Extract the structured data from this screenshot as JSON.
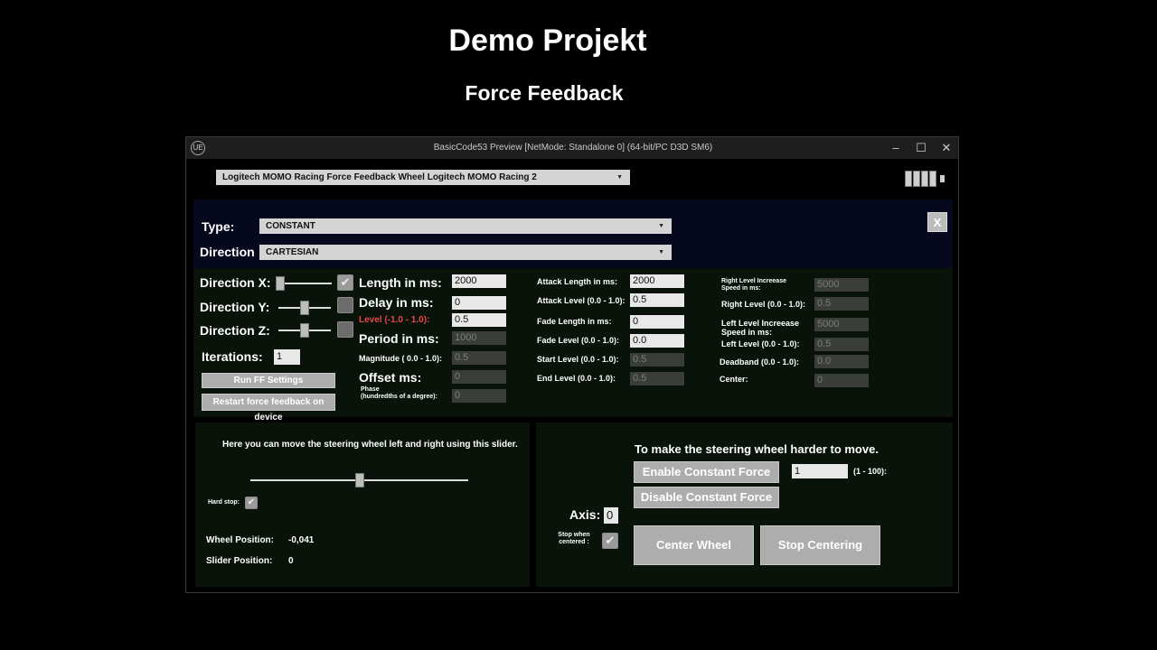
{
  "page": {
    "title": "Demo Projekt",
    "subtitle": "Force Feedback"
  },
  "window": {
    "title": "BasicCode53 Preview [NetMode: Standalone 0]  (64-bit/PC D3D SM6)",
    "logo": "UE",
    "minimize": "–",
    "maximize": "☐",
    "close": "✕"
  },
  "device_select": {
    "value": "Logitech MOMO Racing Force Feedback Wheel Logitech MOMO Racing 2"
  },
  "battery": {
    "icon": "battery-icon",
    "level": 1.0
  },
  "effect": {
    "type_label": "Type:",
    "type_value": "CONSTANT",
    "direction_label": "Direction",
    "direction_value": "CARTESIAN",
    "close_label": "X"
  },
  "directions": {
    "x_label": "Direction X:",
    "y_label": "Direction Y:",
    "z_label": "Direction Z:",
    "x_value": 0.0,
    "y_value": 0.5,
    "z_value": 0.5,
    "iterations_label": "Iterations:",
    "iterations_value": "1",
    "run_button": "Run FF Settings",
    "restart_button": "Restart force feedback on device"
  },
  "timing": {
    "length_label": "Length in ms:",
    "length_value": "2000",
    "delay_label": "Delay in ms:",
    "delay_value": "0",
    "level_label": "Level (-1.0 - 1.0):",
    "level_value": "0.5",
    "period_label": "Period in ms:",
    "period_value": "1000",
    "magnitude_label": "Magnitude ( 0.0 - 1.0):",
    "magnitude_value": "0.5",
    "offset_label": "Offset ms:",
    "offset_value": "0",
    "phase_label": "Phase",
    "phase_sub": "(hundredths of a degree):",
    "phase_value": "0"
  },
  "envelope": {
    "attack_length_label": "Attack Length in ms:",
    "attack_length_value": "2000",
    "attack_level_label": "Attack Level (0.0 - 1.0):",
    "attack_level_value": "0.5",
    "fade_length_label": "Fade Length in ms:",
    "fade_length_value": "0",
    "fade_level_label": "Fade Level (0.0 - 1.0):",
    "fade_level_value": "0.0",
    "start_level_label": "Start Level (0.0 - 1.0):",
    "start_level_value": "0.5",
    "end_level_label": "End Level (0.0 - 1.0):",
    "end_level_value": "0.5"
  },
  "condition": {
    "right_speed_label": "Right Level Increease Speed in ms:",
    "right_speed_value": "5000",
    "right_level_label": "Right Level (0.0 - 1.0):",
    "right_level_value": "0.5",
    "left_speed_label": "Left Level Increease Speed in ms:",
    "left_speed_value": "5000",
    "left_level_label": "Left Level (0.0 - 1.0):",
    "left_level_value": "0.5",
    "deadband_label": "Deadband (0.0 - 1.0):",
    "deadband_value": "0.0",
    "center_label": "Center:",
    "center_value": "0"
  },
  "steering": {
    "hint": "Here you can move the steering wheel left and right using this slider.",
    "slider_value": 0.5,
    "hard_stop_label": "Hard stop:",
    "wheel_position_label": "Wheel Position:",
    "wheel_position_value": "-0,041",
    "slider_position_label": "Slider Position:",
    "slider_position_value": "0"
  },
  "constant_force": {
    "heading": "To make the steering wheel harder to move.",
    "enable_button": "Enable Constant Force",
    "disable_button": "Disable Constant Force",
    "strength_value": "1",
    "range_label": "(1 - 100):",
    "axis_label": "Axis:",
    "axis_value": "0",
    "stop_centered_label": "Stop when centered :",
    "center_button": "Center Wheel",
    "stop_button": "Stop Centering"
  }
}
